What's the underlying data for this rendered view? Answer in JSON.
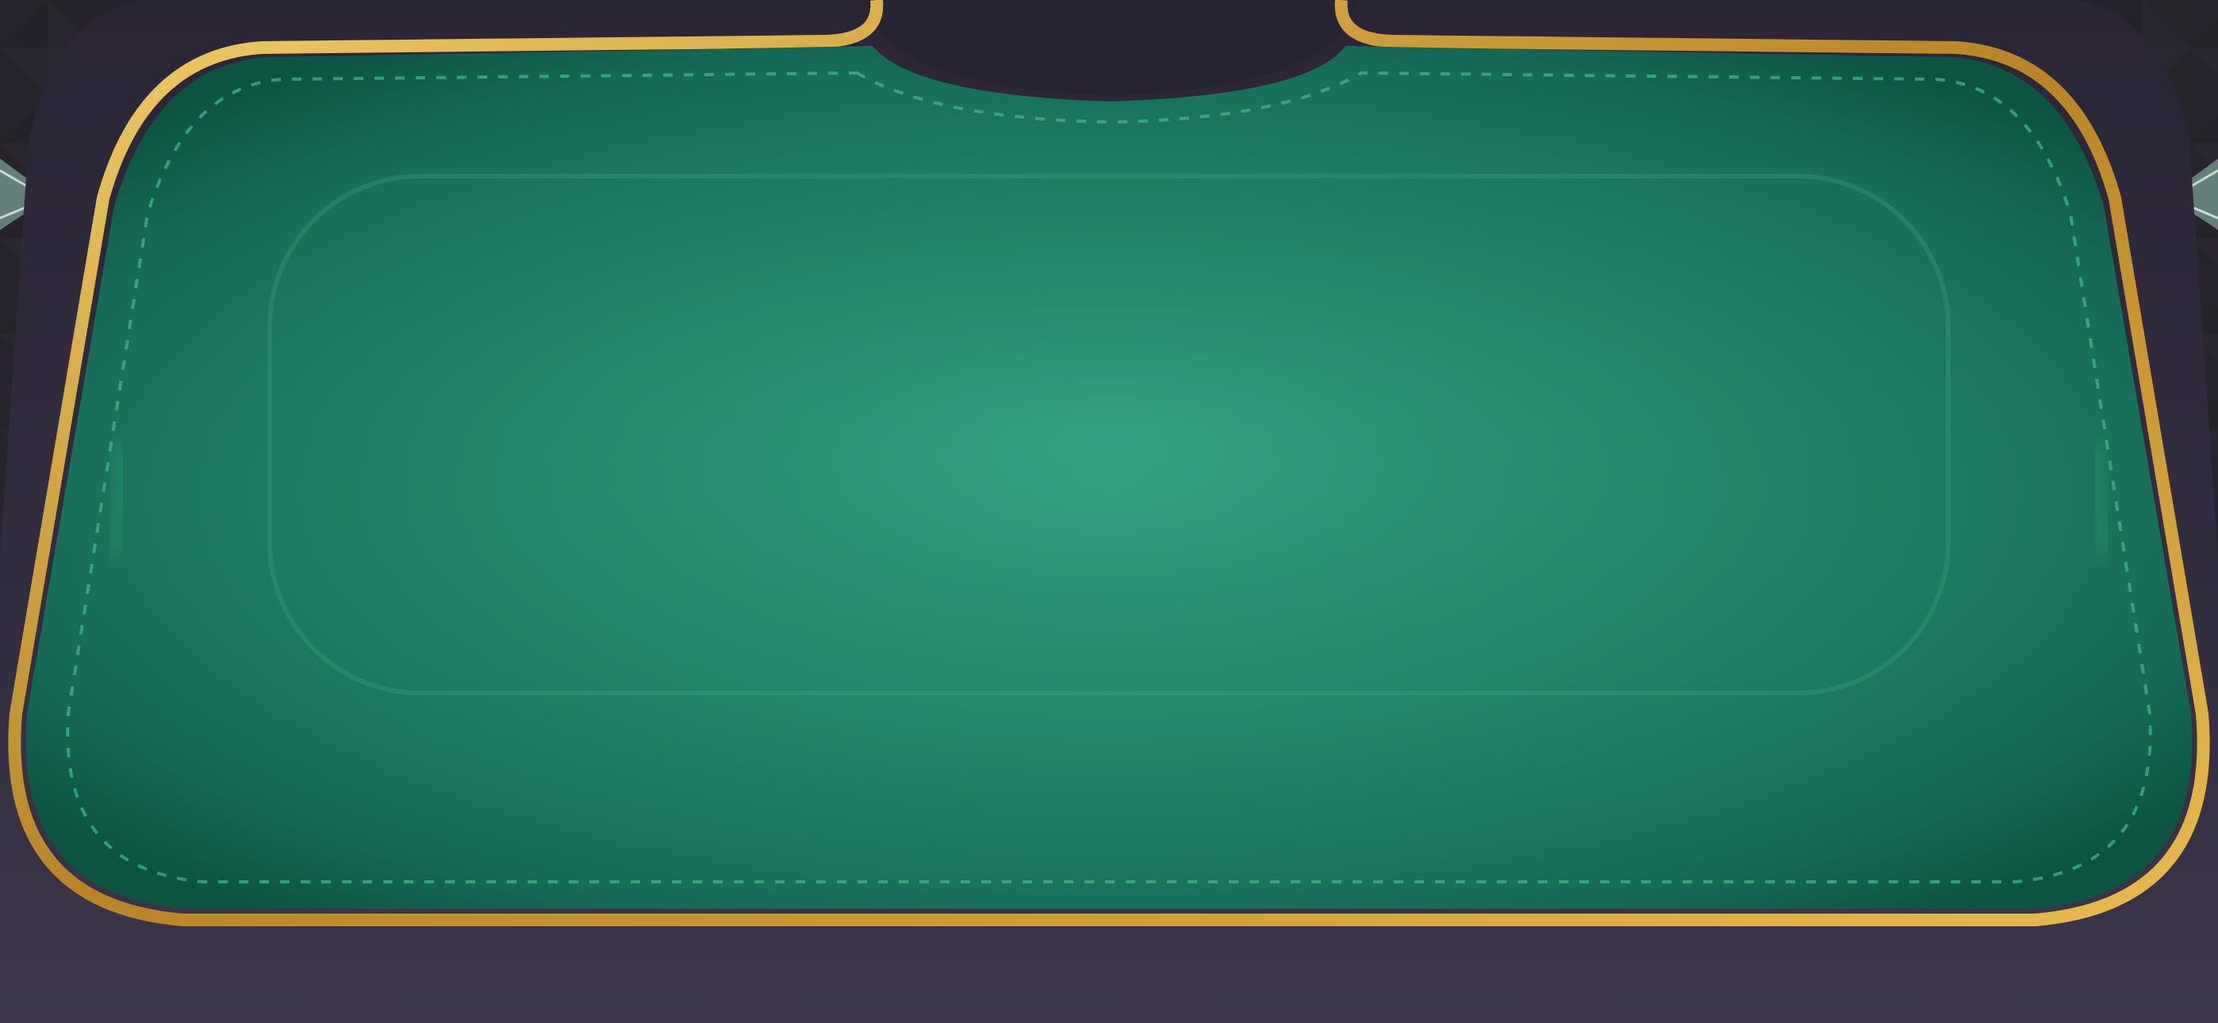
{
  "scene": {
    "type": "card-game-table",
    "state": "empty-table",
    "colors": {
      "felt_center": "#34a082",
      "felt_mid": "#1f7e66",
      "felt_edge": "#0f5a49",
      "felt_stitch": "#3fbf8a",
      "gold_trim": "#d6a43a",
      "leather_rail": "#2e2a3b",
      "background": "#1e1c24",
      "notch_crystal": "#5a83cf"
    },
    "icons": {
      "left_ornament": "leaf-ornament-icon",
      "right_ornament": "leaf-ornament-icon",
      "top_center": "crystal-diamond-icon"
    }
  }
}
